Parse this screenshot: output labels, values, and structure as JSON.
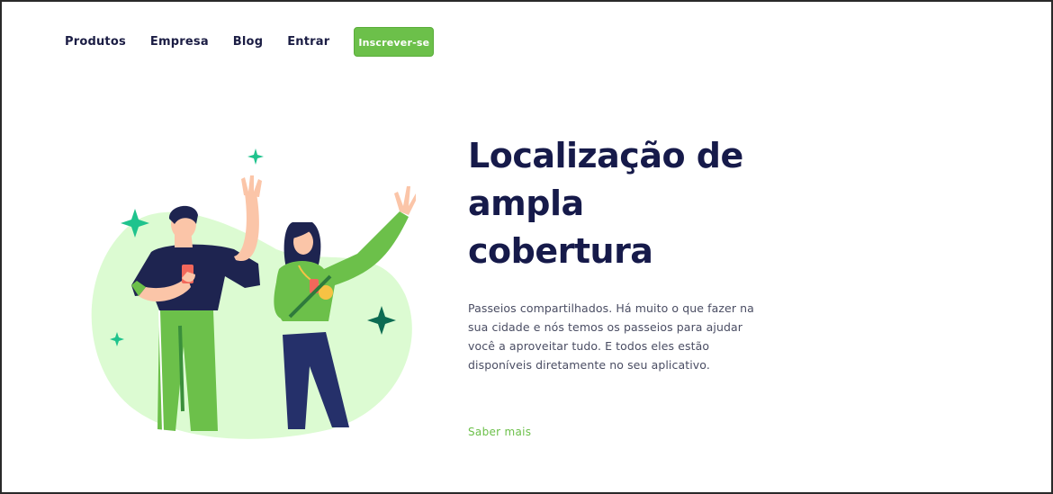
{
  "nav": {
    "items": [
      {
        "label": "Produtos"
      },
      {
        "label": "Empresa"
      },
      {
        "label": "Blog"
      },
      {
        "label": "Entrar"
      }
    ],
    "signup_label": "Inscrever-se"
  },
  "hero": {
    "title_lines": [
      "Localização de",
      "ampla",
      "cobertura"
    ],
    "description": "Passeios compartilhados. Há muito o que fazer na sua cidade e nós temos os passeios para ajudar você a aproveitar tudo. E todos eles estão disponíveis diretamente no seu aplicativo.",
    "link_label": "Saber mais",
    "illustration_icons": [
      "sparkle-icon",
      "person-waving",
      "phone-icon",
      "medal-icon"
    ]
  },
  "colors": {
    "accent_green": "#6cc04a",
    "navy": "#161a4a",
    "blob": "#dcfbd2",
    "sparkle_teal": "#1fc38d",
    "sparkle_dark": "#0c6b52"
  }
}
